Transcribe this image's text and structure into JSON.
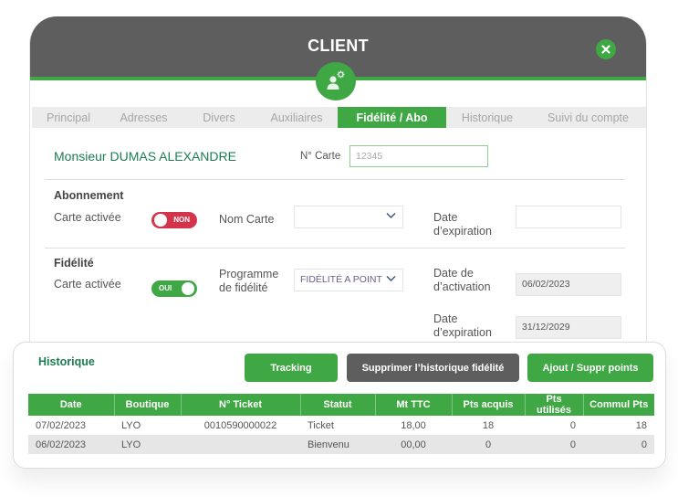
{
  "window": {
    "title": "CLIENT",
    "close_icon": "close-x-icon",
    "avatar_icon": "user-settings-icon"
  },
  "tabs": [
    {
      "label": "Principal",
      "active": false
    },
    {
      "label": "Adresses",
      "active": false
    },
    {
      "label": "Divers",
      "active": false
    },
    {
      "label": "Auxiliaires",
      "active": false
    },
    {
      "label": "Fidélité / Abo",
      "active": true
    },
    {
      "label": "Historique",
      "active": false
    },
    {
      "label": "Suivi du compte",
      "active": false
    }
  ],
  "customer": {
    "name": "Monsieur DUMAS ALEXANDRE",
    "card_number_label": "N° Carte",
    "card_number": "12345"
  },
  "abonnement": {
    "title": "Abonnement",
    "carte_activee_label": "Carte activée",
    "toggle_label": "NON",
    "toggle_on": false,
    "nom_carte_label": "Nom Carte",
    "nom_carte_value": "",
    "date_expiration_label_1": "Date",
    "date_expiration_label_2": "d’expiration",
    "date_expiration_value": ""
  },
  "fidelite": {
    "title": "Fidélité",
    "carte_activee_label": "Carte activée",
    "toggle_label": "OUI",
    "toggle_on": true,
    "programme_label_1": "Programme",
    "programme_label_2": "de fidélité",
    "programme_value": "FIDÉLITÉ A POINT",
    "date_activation_label_1": "Date de",
    "date_activation_label_2": "d’activation",
    "date_activation_value": "06/02/2023",
    "date_expiration_label_1": "Date",
    "date_expiration_label_2": "d’expiration",
    "date_expiration_value": "31/12/2029"
  },
  "historique": {
    "title": "Historique",
    "buttons": {
      "tracking": "Tracking",
      "supprimer": "Supprimer l’historique fidélité",
      "ajout": "Ajout / Suppr points"
    },
    "columns": [
      "Date",
      "Boutique",
      "N° Ticket",
      "Statut",
      "Mt TTC",
      "Pts acquis",
      "Pts utilisés",
      "Commul Pts"
    ],
    "rows": [
      [
        "07/02/2023",
        "LYO",
        "0010590000022",
        "Ticket",
        "18,00",
        "18",
        "0",
        "18"
      ],
      [
        "06/02/2023",
        "LYO",
        "",
        "Bienvenu",
        "00,00",
        "0",
        "0",
        "0"
      ]
    ]
  },
  "colors": {
    "brand_green": "#3fa844",
    "header_grey": "#5e5e5e",
    "name_green": "#1d7d52",
    "toggle_off_red": "#d3344a"
  }
}
